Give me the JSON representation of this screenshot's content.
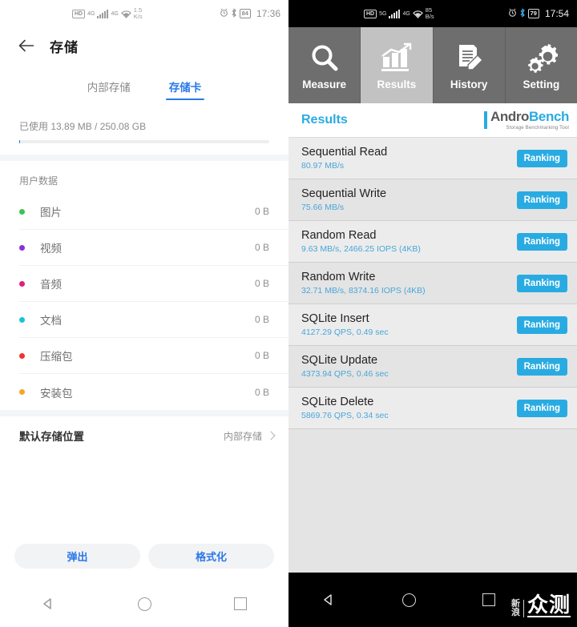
{
  "left": {
    "status": {
      "hd": "HD",
      "net_gen": "4G",
      "net_gen2": "4G",
      "speed_value": "1.5",
      "speed_unit": "K/s",
      "battery": "84",
      "time": "17:36"
    },
    "appbar": {
      "back_icon": "back-arrow-icon",
      "title": "存储"
    },
    "tabs": [
      {
        "label": "内部存储",
        "active": false
      },
      {
        "label": "存储卡",
        "active": true
      }
    ],
    "usage_text": "已使用 13.89 MB / 250.08 GB",
    "section_title": "用户数据",
    "rows": [
      {
        "label": "图片",
        "value": "0 B",
        "color": "#3fc14f"
      },
      {
        "label": "视频",
        "value": "0 B",
        "color": "#8b2fd6"
      },
      {
        "label": "音频",
        "value": "0 B",
        "color": "#e01f7a"
      },
      {
        "label": "文档",
        "value": "0 B",
        "color": "#18c4d8"
      },
      {
        "label": "压缩包",
        "value": "0 B",
        "color": "#f0342c"
      },
      {
        "label": "安装包",
        "value": "0 B",
        "color": "#f5a623"
      }
    ],
    "default_location": {
      "label": "默认存储位置",
      "value": "内部存储"
    },
    "actions": [
      {
        "label": "弹出"
      },
      {
        "label": "格式化"
      }
    ],
    "navbar": [
      "back-triangle-icon",
      "home-circle-icon",
      "recents-square-icon"
    ],
    "accent": "#2a78e8"
  },
  "right": {
    "status": {
      "hd": "HD",
      "net_gen": "5G",
      "net_gen2": "4G",
      "speed_value": "85",
      "speed_unit": "B/s",
      "battery": "79",
      "time": "17:54"
    },
    "tabs": [
      {
        "label": "Measure",
        "icon": "magnifier-icon",
        "active": false
      },
      {
        "label": "Results",
        "icon": "bar-chart-icon",
        "active": true
      },
      {
        "label": "History",
        "icon": "document-pen-icon",
        "active": false
      },
      {
        "label": "Setting",
        "icon": "gears-icon",
        "active": false
      }
    ],
    "header": {
      "title": "Results",
      "logo_part1": "Andro",
      "logo_part2": "Bench",
      "logo_subtitle": "Storage Benchmarking Tool"
    },
    "ranking_label": "Ranking",
    "results": [
      {
        "name": "Sequential Read",
        "value": "80.97 MB/s"
      },
      {
        "name": "Sequential Write",
        "value": "75.66 MB/s"
      },
      {
        "name": "Random Read",
        "value": "9.63 MB/s, 2466.25 IOPS (4KB)"
      },
      {
        "name": "Random Write",
        "value": "32.71 MB/s, 8374.16 IOPS (4KB)"
      },
      {
        "name": "SQLite Insert",
        "value": "4127.29 QPS, 0.49 sec"
      },
      {
        "name": "SQLite Update",
        "value": "4373.94 QPS, 0.46 sec"
      },
      {
        "name": "SQLite Delete",
        "value": "5869.76 QPS, 0.34 sec"
      }
    ],
    "watermark": {
      "small_line1": "新",
      "small_line2": "浪",
      "big": "众测"
    },
    "navbar": [
      "back-triangle-icon",
      "home-circle-icon",
      "recents-square-icon"
    ],
    "accent": "#29abe2"
  }
}
